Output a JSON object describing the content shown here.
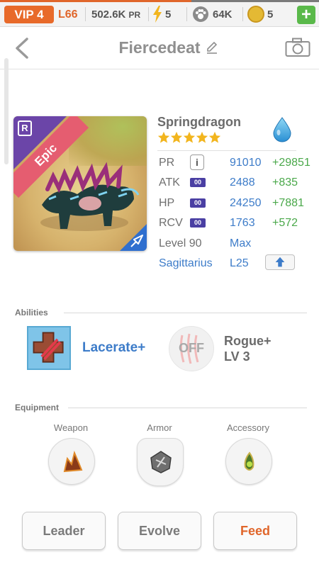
{
  "status_bar": {
    "vip": "VIP 4",
    "level": "L66",
    "pr_total": "502.6K",
    "pr_unit": "PR",
    "energy": "5",
    "food": "64K",
    "gems": "5",
    "plus": "+"
  },
  "header": {
    "title": "Fiercedeat"
  },
  "monster": {
    "name": "Springdragon",
    "rarity": "Epic",
    "rarity_badge": "R",
    "stars": 5,
    "element": "water"
  },
  "stats": {
    "pr": {
      "label": "PR",
      "value": "91010",
      "bonus": "+29851",
      "info": "i"
    },
    "atk": {
      "label": "ATK",
      "value": "2488",
      "bonus": "+835",
      "pips": "00"
    },
    "hp": {
      "label": "HP",
      "value": "24250",
      "bonus": "+7881",
      "pips": "00"
    },
    "rcv": {
      "label": "RCV",
      "value": "1763",
      "bonus": "+572",
      "pips": "00"
    },
    "level": {
      "label": "Level 90",
      "value": "Max"
    },
    "constellation": {
      "label": "Sagittarius",
      "value": "L25"
    }
  },
  "abilities": {
    "title": "Abilities",
    "active_name": "Lacerate+",
    "off_label": "OFF",
    "passive_name": "Rogue+",
    "passive_level": "LV 3"
  },
  "equipment": {
    "title": "Equipment",
    "weapon": "Weapon",
    "armor": "Armor",
    "accessory": "Accessory"
  },
  "buttons": {
    "leader": "Leader",
    "evolve": "Evolve",
    "feed": "Feed"
  },
  "colors": {
    "accent_orange": "#e0662b",
    "stat_blue": "#3d7cc9",
    "bonus_green": "#4aa84a",
    "epic_ribbon": "#e55d70"
  }
}
